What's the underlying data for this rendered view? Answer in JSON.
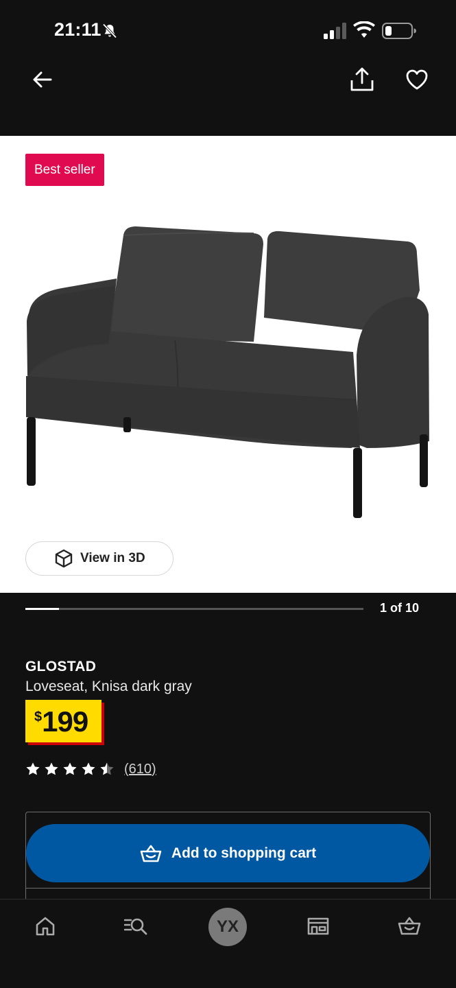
{
  "status_bar": {
    "time": "21:11"
  },
  "product": {
    "badge": "Best seller",
    "view_3d_label": "View in 3D",
    "carousel_counter": "1 of 10",
    "carousel_progress": 0.1,
    "name": "GLOSTAD",
    "description": "Loveseat, Knisa dark gray",
    "price_currency": "$",
    "price_amount": "199",
    "rating_value": 4.5,
    "rating_max": 5,
    "review_count": "(610)"
  },
  "cart": {
    "add_label": "Add to shopping cart"
  },
  "bottom_nav": {
    "avatar_initials": "YX"
  },
  "colors": {
    "background": "#111111",
    "badge": "#df0a4f",
    "price_bg": "#ffdb00",
    "price_shadow": "#cc0008",
    "cart_button": "#0058a3"
  }
}
